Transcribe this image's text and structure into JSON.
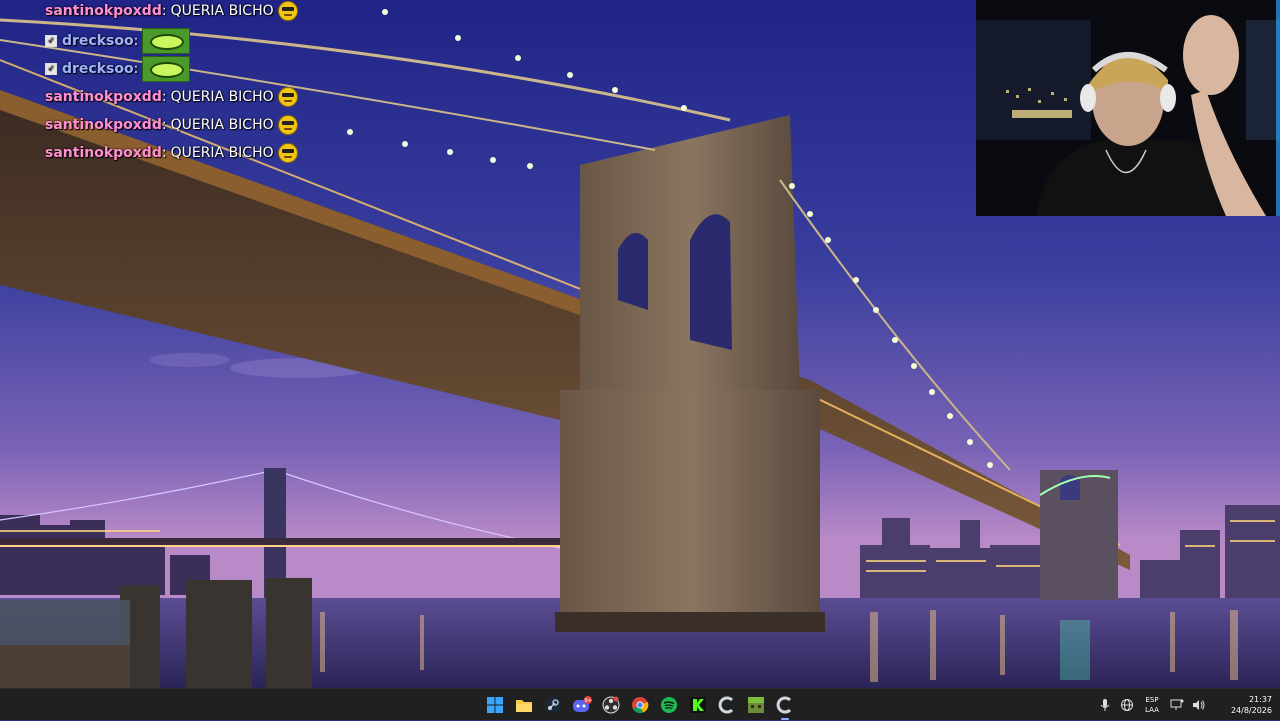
{
  "chat": {
    "messages": [
      {
        "user": "santinokpoxdd",
        "sep": ":",
        "text": "QUERIA BICHO",
        "emote": "pepe-face-emote",
        "badge": false,
        "color": "pink"
      },
      {
        "user": "drecksoo",
        "sep": ":",
        "text": "",
        "emote": "green-mouth-emote",
        "badge": true,
        "color": "blue"
      },
      {
        "user": "drecksoo",
        "sep": ":",
        "text": "",
        "emote": "green-mouth-emote",
        "badge": true,
        "color": "blue"
      },
      {
        "user": "santinokpoxdd",
        "sep": ":",
        "text": "QUERIA BICHO",
        "emote": "pepe-face-emote",
        "badge": false,
        "color": "pink"
      },
      {
        "user": "santinokpoxdd",
        "sep": ":",
        "text": "QUERIA BICHO",
        "emote": "pepe-face-emote",
        "badge": false,
        "color": "pink"
      },
      {
        "user": "santinokpoxdd",
        "sep": ":",
        "text": "QUERIA BICHO",
        "emote": "pepe-face-emote",
        "badge": false,
        "color": "pink"
      }
    ]
  },
  "taskbar": {
    "pinned": [
      {
        "name": "windows-start-icon"
      },
      {
        "name": "file-explorer-icon"
      },
      {
        "name": "steam-icon"
      },
      {
        "name": "discord-icon",
        "badge": "9+"
      },
      {
        "name": "obs-icon"
      },
      {
        "name": "chrome-icon"
      },
      {
        "name": "spotify-icon"
      },
      {
        "name": "kick-icon"
      },
      {
        "name": "app-c-icon"
      },
      {
        "name": "minecraft-icon"
      },
      {
        "name": "app-c-active-icon"
      }
    ],
    "tray": {
      "language_line1": "ESP",
      "language_line2": "LAA",
      "time": "21:37",
      "date": "24/8/2026"
    }
  },
  "colors": {
    "taskbar_bg": "#202020",
    "sky_top": "#1f2c86",
    "sky_bottom": "#b07ac0",
    "username_pink": "#ff8fd0",
    "username_blue": "#9fb3ff"
  }
}
